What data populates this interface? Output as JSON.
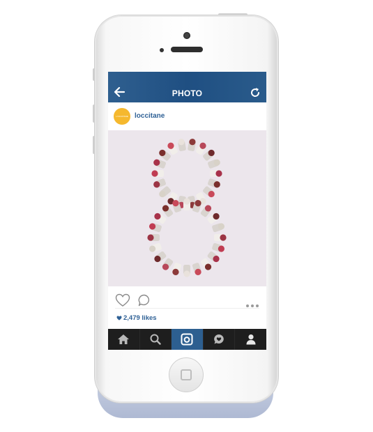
{
  "header": {
    "title": "PHOTO",
    "back_icon": "back-arrow-icon",
    "refresh_icon": "refresh-icon",
    "color": "#1f4f82"
  },
  "post": {
    "username": "loccitane",
    "avatar_text": "L'OCCITANE",
    "avatar_color": "#f5b82e",
    "image_alt": "lipsticks arranged in the shape of the number 8",
    "likes": "2,479 likes"
  },
  "actions": {
    "like_icon": "heart-icon",
    "comment_icon": "comment-icon",
    "more_icon": "more-dots-icon"
  },
  "tabbar": {
    "tabs": [
      {
        "icon": "home-icon",
        "active": false
      },
      {
        "icon": "search-icon",
        "active": false
      },
      {
        "icon": "camera-icon",
        "active": true
      },
      {
        "icon": "activity-icon",
        "active": false
      },
      {
        "icon": "profile-icon",
        "active": false
      }
    ],
    "active_color": "#2d5f90"
  }
}
